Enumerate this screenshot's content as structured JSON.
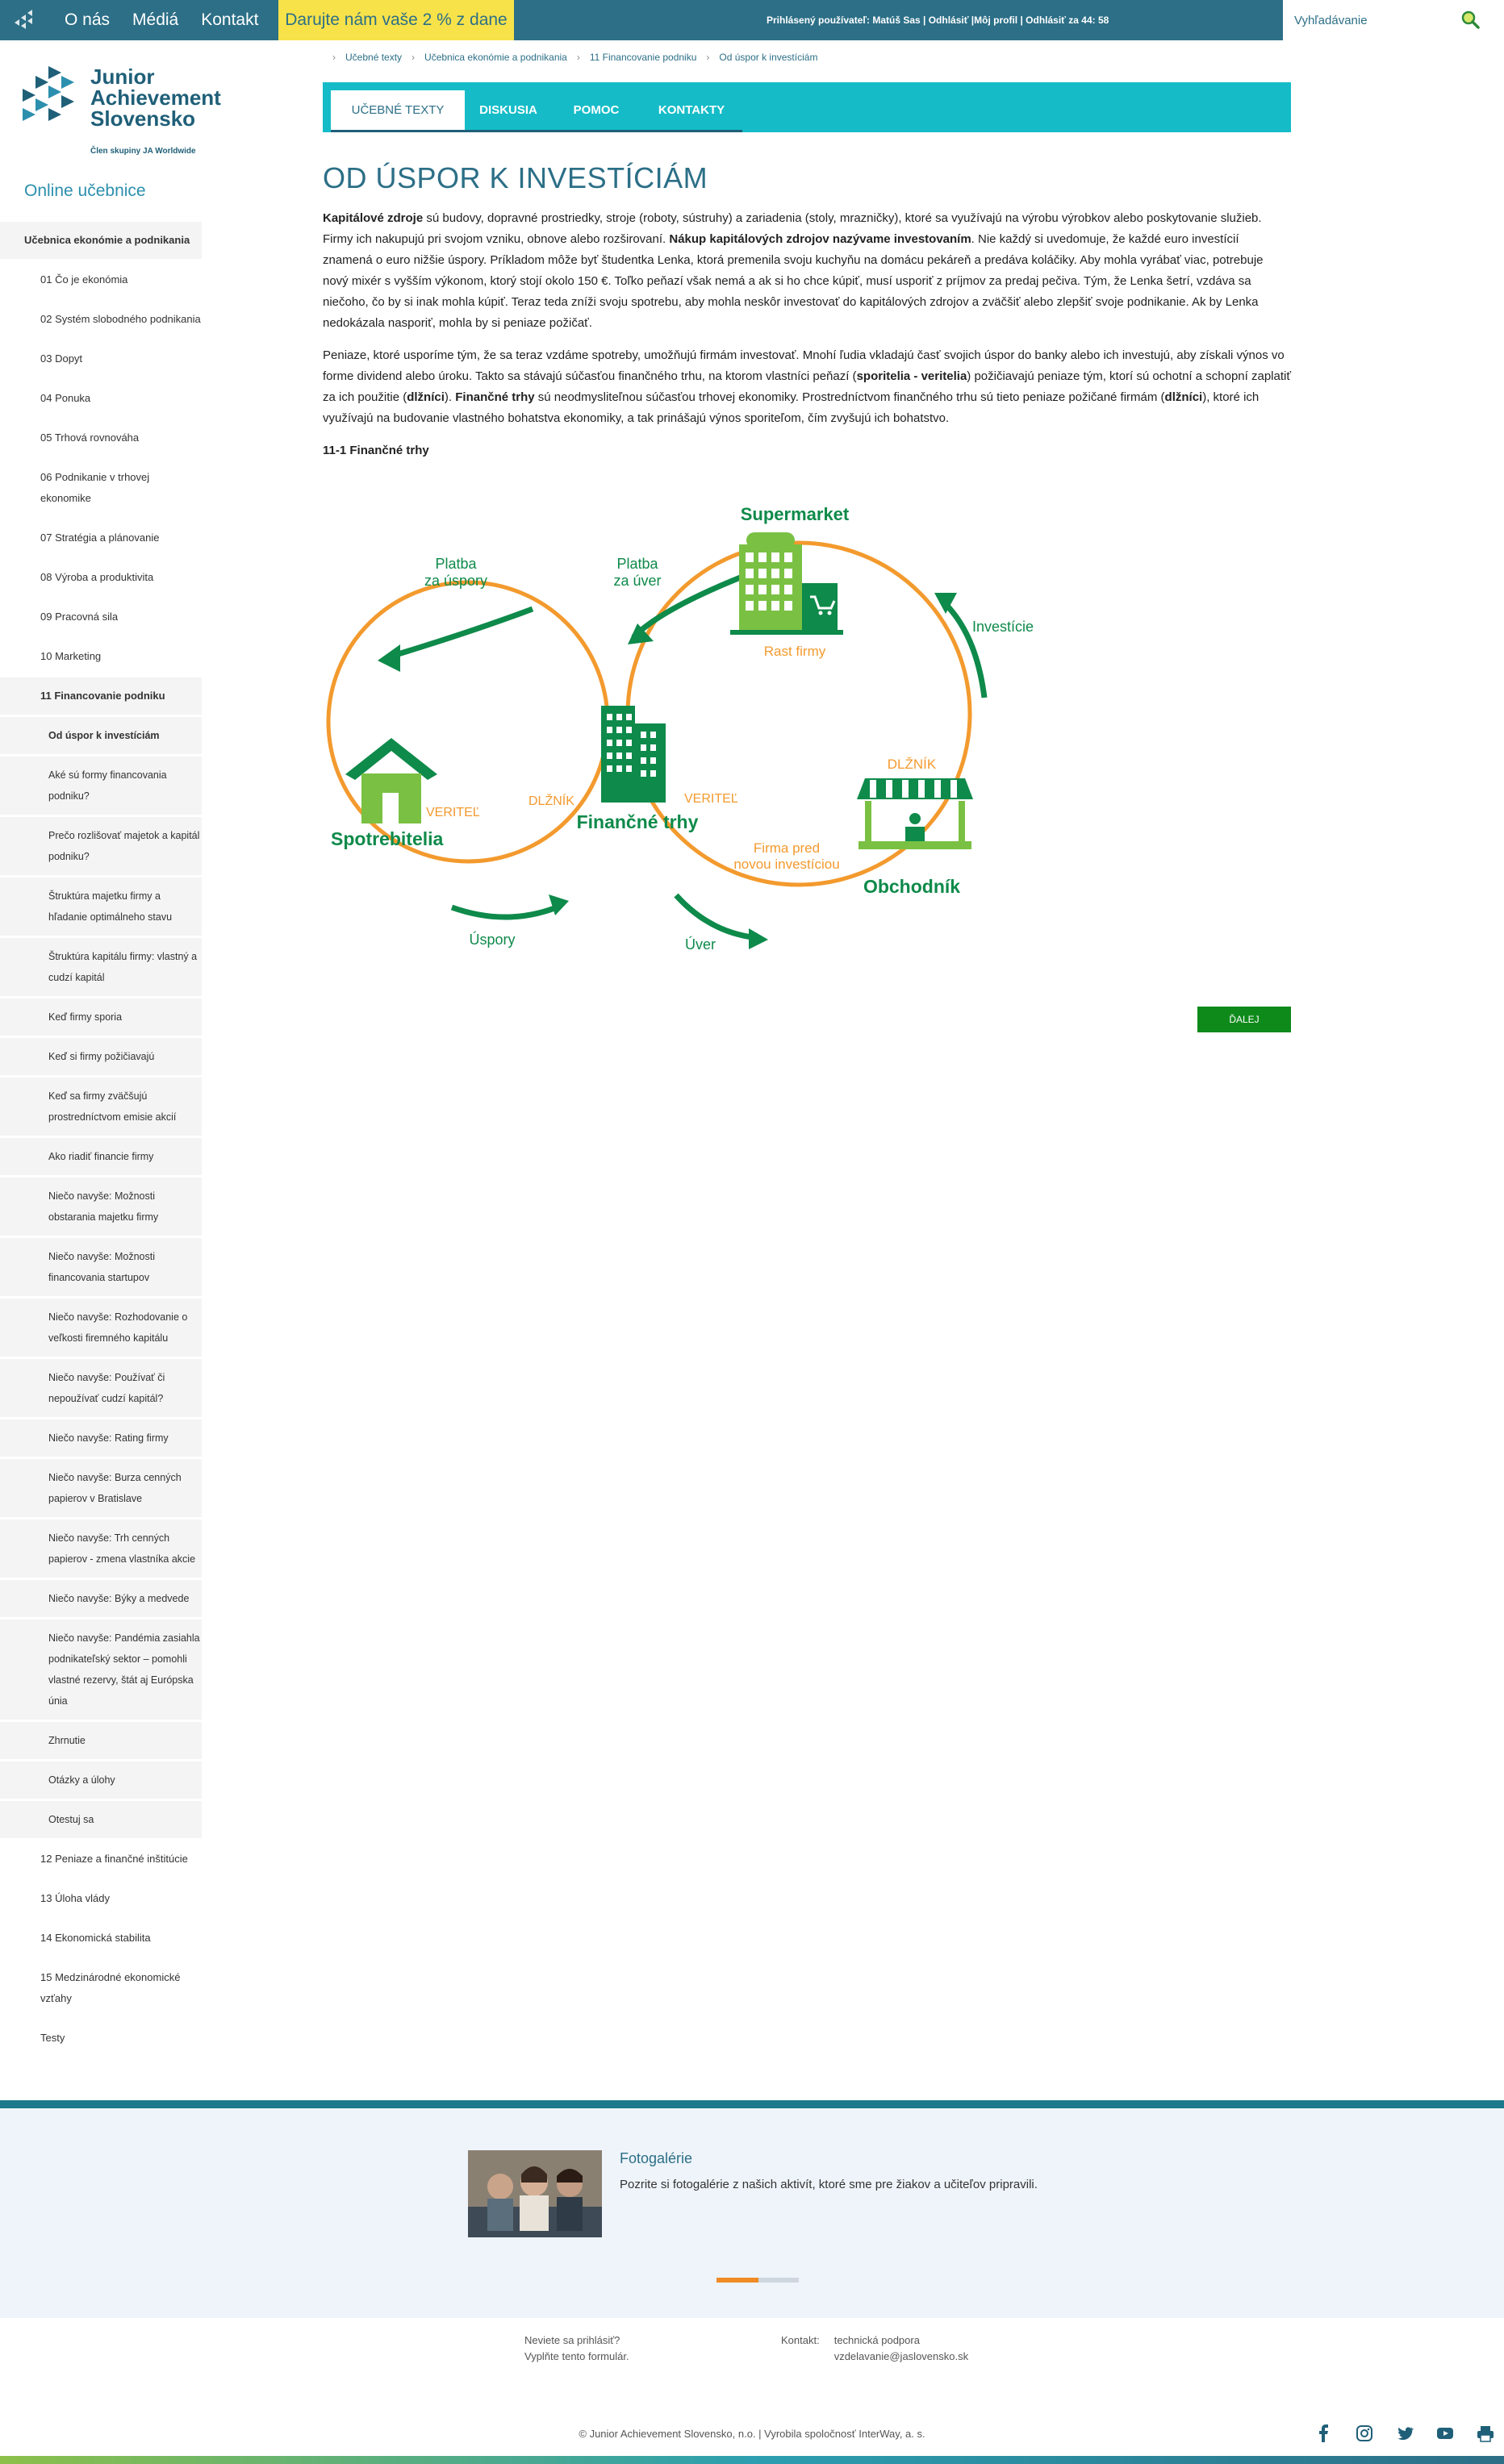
{
  "topbar": {
    "nav": [
      "O nás",
      "Médiá",
      "Kontakt"
    ],
    "donate": "Darujte nám vaše 2 % z dane",
    "user_info": "Prihlásený používateľ: Matúš Sas | Odhlásiť |Môj profil | Odhlásiť za 44: 58",
    "search_placeholder": "Vyhľadávanie"
  },
  "brand": {
    "name_line1": "Junior",
    "name_line2": "Achievement",
    "name_line3": "Slovensko",
    "tagline": "Člen skupiny JA Worldwide"
  },
  "sidebar": {
    "title": "Online učebnice",
    "book": "Učebnica ekonómie a podnikania",
    "chapters_before": [
      "01 Čo je ekonómia",
      "02 Systém slobodného podnikania",
      "03 Dopyt",
      "04 Ponuka",
      "05 Trhová rovnováha",
      "06 Podnikanie v trhovej ekonomike",
      "07 Stratégia a plánovanie",
      "08 Výroba a produktivita",
      "09 Pracovná sila",
      "10 Marketing"
    ],
    "active_chapter": "11 Financovanie podniku",
    "subsections": [
      "Od úspor k investíciám",
      "Aké sú formy financovania podniku?",
      "Prečo rozlišovať majetok a kapitál podniku?",
      "Štruktúra majetku firmy a hľadanie optimálneho stavu",
      "Štruktúra kapitálu firmy: vlastný a cudzí kapitál",
      "Keď firmy sporia",
      "Keď si firmy požičiavajú",
      "Keď sa firmy zväčšujú prostredníctvom emisie akcií",
      "Ako riadiť financie firmy",
      "Niečo navyše: Možnosti obstarania majetku firmy",
      "Niečo navyše: Možnosti financovania startupov",
      "Niečo navyše: Rozhodovanie o veľkosti firemného kapitálu",
      "Niečo navyše: Používať či nepoužívať cudzí kapitál?",
      "Niečo navyše: Rating firmy",
      "Niečo navyše: Burza cenných papierov v Bratislave",
      "Niečo navyše: Trh cenných papierov - zmena vlastníka akcie",
      "Niečo navyše: Býky a medvede",
      "Niečo navyše: Pandémia zasiahla podnikateľský sektor – pomohli vlastné rezervy, štát aj Európska únia",
      "Zhrnutie",
      "Otázky a úlohy",
      "Otestuj sa"
    ],
    "chapters_after": [
      "12 Peniaze a finančné inštitúcie",
      "13 Úloha vlády",
      "14 Ekonomická stabilita",
      "15 Medzinárodné ekonomické vzťahy",
      "Testy"
    ]
  },
  "breadcrumb": [
    "Učebné texty",
    "Učebnica ekonómie a podnikania",
    "11 Financovanie podniku",
    "Od úspor k investíciám"
  ],
  "tabs": [
    "UČEBNÉ TEXTY",
    "DISKUSIA",
    "POMOC",
    "KONTAKTY"
  ],
  "article": {
    "title": "OD ÚSPOR K INVESTÍCIÁM",
    "p1_b1": "Kapitálové zdroje",
    "p1_t1": " sú budovy, dopravné prostriedky, stroje (roboty, sústruhy) a zariadenia (stoly, mrazničky), ktoré sa využívajú na výrobu výrobkov alebo poskytovanie služieb. Firmy ich nakupujú pri svojom vzniku, obnove alebo rozširovaní. ",
    "p1_b2": "Nákup kapitálových zdrojov nazývame investovaním",
    "p1_t2": ". Nie každý si uvedomuje, že každé euro investícií znamená o euro nižšie úspory. Príkladom môže byť študentka Lenka, ktorá premenila svoju kuchyňu na domácu pekáreň a predáva koláčiky. Aby mohla vyrábať viac, potrebuje nový mixér s vyšším výkonom, ktorý stojí okolo 150 €. Toľko peňazí však nemá a ak si ho chce kúpiť, musí usporiť z príjmov za predaj pečiva. Tým, že Lenka šetrí, vzdáva sa niečoho, čo by si inak mohla kúpiť. Teraz teda zníži svoju spotrebu, aby mohla neskôr investovať do kapitálových zdrojov a zväčšiť alebo zlepšiť svoje podnikanie. Ak by Lenka nedokázala nasporiť, mohla by si peniaze požičať.",
    "p2_t1": "Peniaze, ktoré usporíme tým, že sa teraz vzdáme spotreby, umožňujú firmám investovať. Mnohí ľudia vkladajú časť svojich úspor do banky alebo ich investujú, aby získali výnos vo forme dividend alebo úroku. Takto sa stávajú súčasťou finančného trhu, na ktorom vlastníci peňazí (",
    "p2_b1": "sporitelia - veritelia",
    "p2_t2": ") požičiavajú peniaze tým, ktorí sú ochotní a schopní zaplatiť za ich použitie (",
    "p2_b2": "dlžníci",
    "p2_t3": "). ",
    "p2_b3": "Finančné trhy",
    "p2_t4": " sú neodmysliteľnou súčasťou trhovej ekonomiky. Prostredníctvom finančného trhu sú tieto peniaze požičané firmám (",
    "p2_b4": "dlžníci",
    "p2_t5": "), ktoré ich využívajú na budovanie vlastného bohatstva ekonomiky, a tak prinášajú výnos sporiteľom, čím zvyšujú ich bohatstvo.",
    "figure_caption": "11-1 Finančné trhy"
  },
  "diagram": {
    "supermarket": "Supermarket",
    "rast_firmy": "Rast firmy",
    "platba_uspory_1": "Platba",
    "platba_uspory_2": "za úspory",
    "platba_uver_1": "Platba",
    "platba_uver_2": "za úver",
    "investicie": "Investície",
    "dlznik_right": "DLŽNÍK",
    "veritel_left": "VERITEĽ",
    "dlznik_mid": "DLŽNÍK",
    "veritel_mid": "VERITEĽ",
    "spotrebitelia": "Spotrebitelia",
    "financne_trhy": "Finančné trhy",
    "firma_1": "Firma pred",
    "firma_2": "novou investíciou",
    "obchodnik": "Obchodník",
    "uspory": "Úspory",
    "uver": "Úver",
    "colors": {
      "green": "#0e8a4a",
      "light_green": "#7ac143",
      "orange": "#f39a2e"
    }
  },
  "next_button": "ĎALEJ",
  "gallery": {
    "title": "Fotogalérie",
    "text": "Pozrite si fotogalérie z našich aktivít, ktoré sme pre žiakov a učiteľov pripravili."
  },
  "footer": {
    "forgot_1": "Neviete sa prihlásiť?",
    "forgot_2": "Vyplňte tento formulár.",
    "contact_label": "Kontakt:",
    "contact_1": "technická podpora",
    "contact_2": "vzdelavanie@jaslovensko.sk",
    "copyright": "© Junior Achievement Slovensko, n.o. | Vyrobila spoločnosť InterWay, a. s.",
    "social_icons": [
      "facebook-icon",
      "instagram-icon",
      "twitter-icon",
      "youtube-icon",
      "print-icon"
    ]
  }
}
